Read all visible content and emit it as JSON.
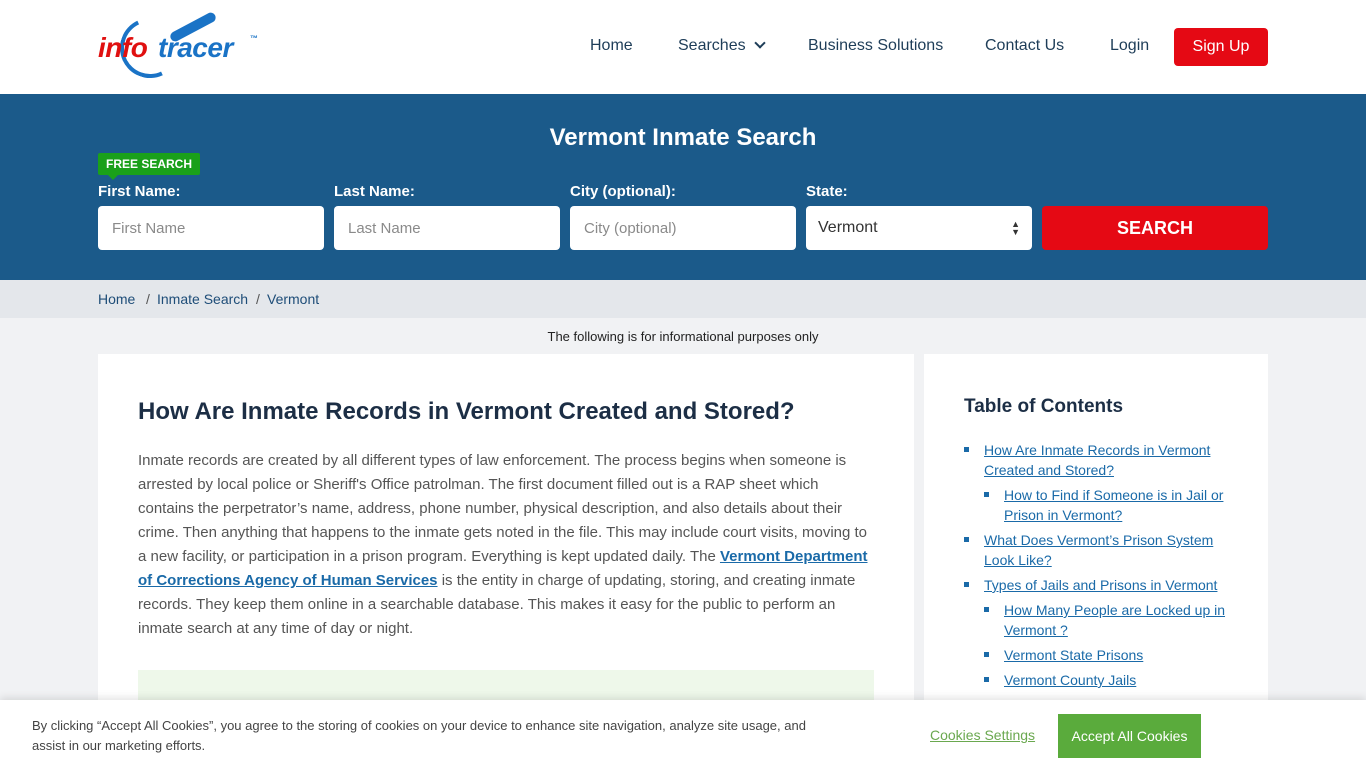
{
  "logo": {
    "part1": "info",
    "part2": "tracer",
    "tm": "™"
  },
  "nav": {
    "home": "Home",
    "searches": "Searches",
    "business": "Business Solutions",
    "contact": "Contact Us",
    "login": "Login",
    "signup": "Sign Up"
  },
  "hero": {
    "title": "Vermont Inmate Search",
    "badge": "FREE SEARCH",
    "first_label": "First Name:",
    "first_placeholder": "First Name",
    "last_label": "Last Name:",
    "last_placeholder": "Last Name",
    "city_label": "City (optional):",
    "city_placeholder": "City (optional)",
    "state_label": "State:",
    "state_value": "Vermont",
    "search_button": "SEARCH"
  },
  "breadcrumb": {
    "items": [
      "Home",
      "Inmate Search",
      "Vermont"
    ],
    "separator": "/"
  },
  "info_note": "The following is for informational purposes only",
  "article": {
    "heading": "How Are Inmate Records in Vermont Created and Stored?",
    "p_before": "Inmate records are created by all different types of law enforcement. The process begins when someone is arrested by local police or Sheriff's Office patrolman. The first document filled out is a RAP sheet which contains the perpetrator’s name, address, phone number, physical description, and also details about their crime. Then anything that happens to the inmate gets noted in the file. This may include court visits, moving to a new facility, or participation in a prison program. Everything is kept updated daily. The ",
    "link": "Vermont Department of Corrections Agency of Human Services",
    "p_after": " is the entity in charge of updating, storing, and creating inmate records. They keep them online in a searchable database. This makes it easy for the public to perform an inmate search at any time of day or night."
  },
  "toc": {
    "title": "Table of Contents",
    "items": [
      {
        "label": "How Are Inmate Records in Vermont Created and Stored?",
        "level": 1
      },
      {
        "label": "How to Find if Someone is in Jail or Prison in Vermont?",
        "level": 2
      },
      {
        "label": "What Does Vermont’s Prison System Look Like?",
        "level": 1
      },
      {
        "label": "Types of Jails and Prisons in Vermont",
        "level": 1
      },
      {
        "label": "How Many People are Locked up in Vermont ?",
        "level": 2
      },
      {
        "label": "Vermont State Prisons",
        "level": 2
      },
      {
        "label": "Vermont County Jails",
        "level": 2
      }
    ]
  },
  "cookie": {
    "text": "By clicking “Accept All Cookies”, you agree to the storing of cookies on your device to enhance site navigation, analyze site usage, and assist in our marketing efforts.",
    "settings": "Cookies Settings",
    "accept": "Accept All Cookies"
  }
}
